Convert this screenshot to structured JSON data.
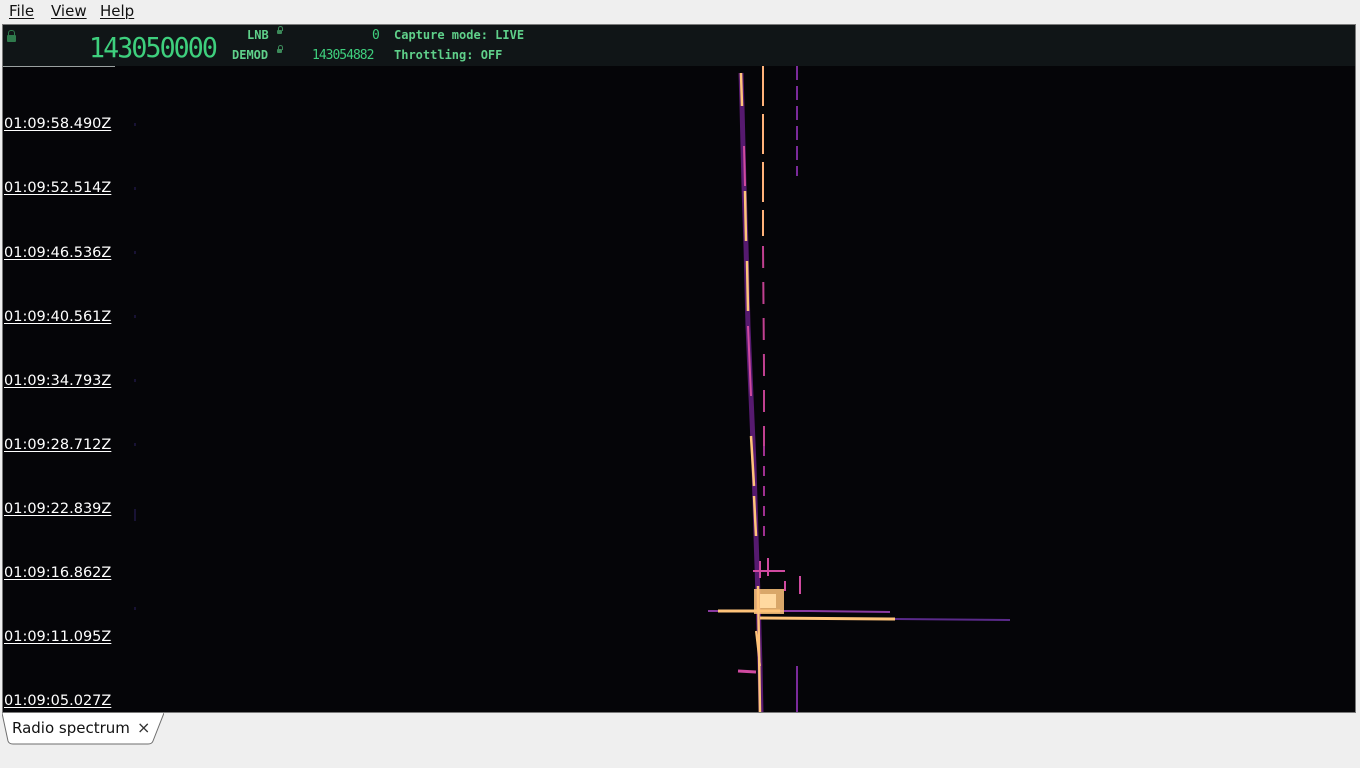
{
  "menu": {
    "file": "File",
    "view": "View",
    "help": "Help"
  },
  "header": {
    "frequency": "143050000",
    "lnb_label": "LNB",
    "lnb_value": "0",
    "demod_label": "DEMOD",
    "demod_value": "143054882",
    "capture_mode": "Capture mode: LIVE",
    "throttling": "Throttling: OFF"
  },
  "time_axis": {
    "labels": [
      "01:09:58.490Z",
      "01:09:52.514Z",
      "01:09:46.536Z",
      "01:09:40.561Z",
      "01:09:34.793Z",
      "01:09:28.712Z",
      "01:09:22.839Z",
      "01:09:16.862Z",
      "01:09:11.095Z",
      "01:09:05.027Z"
    ]
  },
  "tabs": [
    {
      "label": "Radio spectrum",
      "close": "×"
    }
  ],
  "colors": {
    "background": "#050508",
    "lcd": "#3ecf7d",
    "signal_hot": "#ffc47a",
    "signal_mid": "#d04aa0",
    "signal_low": "#5a2a8a"
  }
}
